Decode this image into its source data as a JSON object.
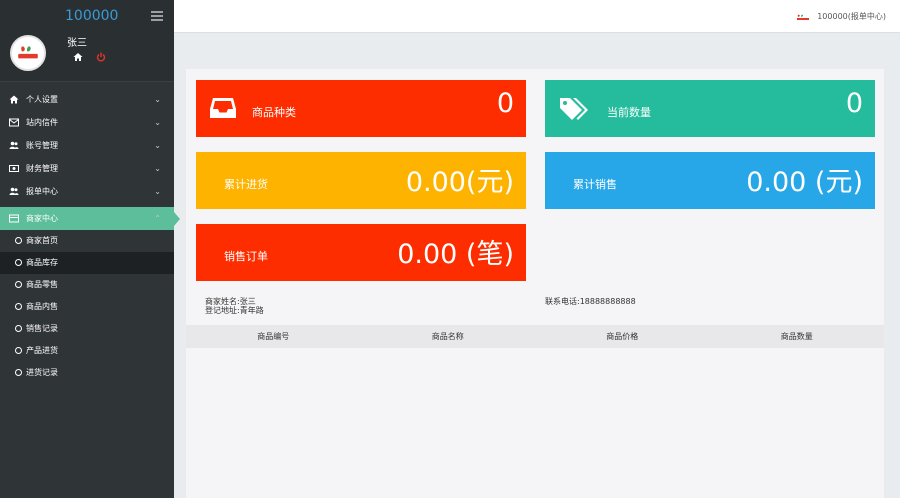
{
  "app": {
    "brand": "100000",
    "user": "张三",
    "topbar_text": "100000(报单中心)"
  },
  "sidebar": {
    "menu": [
      {
        "label": "个人设置",
        "icon": "home-icon"
      },
      {
        "label": "站内信件",
        "icon": "envelope-icon"
      },
      {
        "label": "账号管理",
        "icon": "users-icon"
      },
      {
        "label": "财务管理",
        "icon": "money-icon"
      },
      {
        "label": "报单中心",
        "icon": "users-icon"
      }
    ],
    "active": {
      "label": "商家中心",
      "icon": "card-icon"
    },
    "submenu": [
      {
        "label": "商家首页"
      },
      {
        "label": "商品库存"
      },
      {
        "label": "商品零售"
      },
      {
        "label": "商品内售"
      },
      {
        "label": "销售记录"
      },
      {
        "label": "产品进货"
      },
      {
        "label": "进货记录"
      }
    ]
  },
  "cards": {
    "category": {
      "label": "商品种类",
      "value": "0",
      "color": "#fe2d00"
    },
    "quantity": {
      "label": "当前数量",
      "value": "0",
      "color": "#24bc9c"
    },
    "purchase": {
      "label": "累计进货",
      "value": "0.00(元)",
      "color": "#feb300"
    },
    "sales": {
      "label": "累计销售",
      "value": "0.00 (元)",
      "color": "#27a7e8"
    },
    "orders": {
      "label": "销售订单",
      "value": "0.00 (笔)",
      "color": "#fe2d00"
    }
  },
  "merchant": {
    "name": "商家姓名:张三",
    "address": "登记地址:青年路",
    "phone": "联系电话:18888888888"
  },
  "table": {
    "headers": [
      "商品编号",
      "商品名称",
      "商品价格",
      "商品数量"
    ]
  }
}
